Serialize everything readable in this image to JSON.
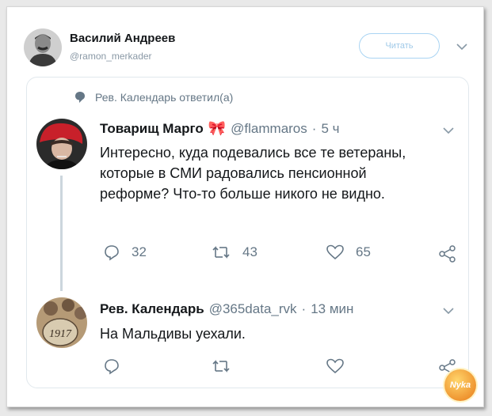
{
  "tweet": {
    "author_name": "Василий Андреев",
    "author_handle": "@ramon_merkader",
    "follow_label": "Читать"
  },
  "quote": {
    "context_label": "Рев. Календарь ответил(а)",
    "reply": {
      "author_name": "Товарищ Марго",
      "emoji": "🎀",
      "handle": "@flammaros",
      "separator": "·",
      "time": "5 ч",
      "text": "Интересно, куда подевались все те ветераны, которые в СМИ радовались пенсионной реформе? Что-то больше никого не видно.",
      "replies": "32",
      "retweets": "43",
      "likes": "65"
    },
    "main": {
      "author_name": "Рев. Календарь",
      "handle": "@365data_rvk",
      "separator": "·",
      "time": "13 мин",
      "text": "На Мальдивы уехали."
    }
  },
  "watermark": "Nyka",
  "colors": {
    "text": "#14171a",
    "secondary": "#657786",
    "follow_border": "#a9d4f3",
    "emoji_bow": "#e0245e"
  }
}
